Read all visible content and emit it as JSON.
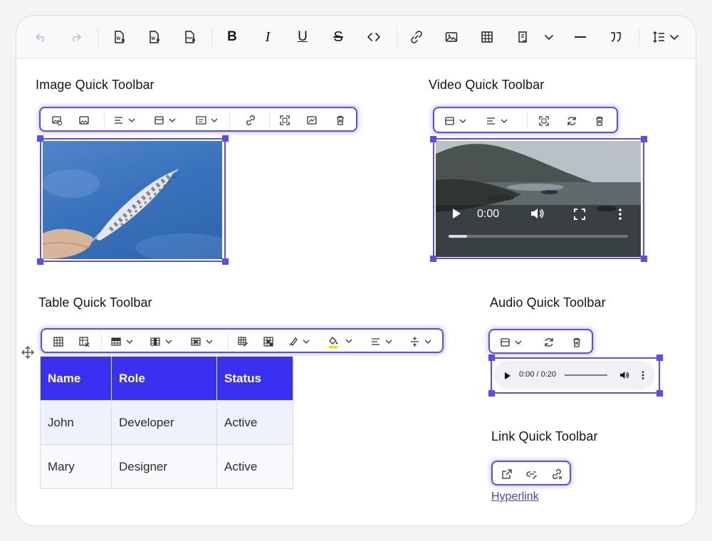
{
  "sections": {
    "image": "Image Quick Toolbar",
    "video": "Video Quick Toolbar",
    "table": "Table Quick Toolbar",
    "audio": "Audio Quick Toolbar",
    "link": "Link Quick Toolbar"
  },
  "main_toolbar": {
    "buttons": [
      "undo",
      "redo",
      "import-word",
      "export-word",
      "export-pdf",
      "bold",
      "italic",
      "underline",
      "strikethrough",
      "code",
      "link",
      "image",
      "table",
      "insert-from-clipboard",
      "horizontal-line",
      "blockquote",
      "line-height"
    ],
    "bold_label": "B",
    "italic_label": "I",
    "underline_label": "U",
    "strike_label": "S"
  },
  "video": {
    "time": "0:00"
  },
  "audio": {
    "time": "0:00 / 0:20"
  },
  "table": {
    "headers": [
      "Name",
      "Role",
      "Status"
    ],
    "rows": [
      [
        "John",
        "Developer",
        "Active"
      ],
      [
        "Mary",
        "Designer",
        "Active"
      ]
    ]
  },
  "link": {
    "text": "Hyperlink"
  },
  "colors": {
    "accent": "#5a4fe0",
    "table_header": "#3a31f0",
    "link": "#4b46c9",
    "highlight_swatch": "#f4e000"
  }
}
